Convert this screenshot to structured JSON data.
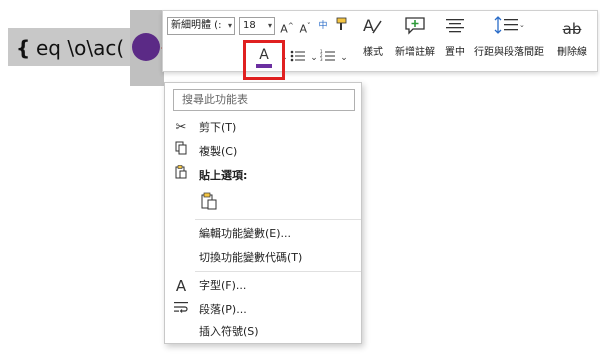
{
  "document": {
    "field_brace": "{",
    "field_code": "eq \\o\\ac("
  },
  "colors": {
    "circle": "#5b2a86",
    "font_color_bar": "#6b2fa0",
    "highlight_box": "#e02020",
    "arrow": "#e02020"
  },
  "toolbar": {
    "font_name": "新細明體 (:",
    "font_size": "18",
    "grow_label": "A^",
    "shrink_label": "A˅",
    "phonetic_label": "中文",
    "style_label": "樣式",
    "comment_label": "新增註解",
    "center_label": "置中",
    "spacing_label": "行距與段落間距",
    "strike_label": "刪除線",
    "font_color_letter": "A"
  },
  "menu": {
    "search_placeholder": "搜尋此功能表",
    "items": [
      {
        "icon": "scissors-icon",
        "label": "剪下(T)"
      },
      {
        "icon": "copy-icon",
        "label": "複製(C)"
      },
      {
        "icon": "paste-icon",
        "label": "貼上選項:"
      },
      {
        "icon": "",
        "label": "編輯功能變數(E)..."
      },
      {
        "icon": "",
        "label": "切換功能變數代碼(T)"
      },
      {
        "icon": "font-icon",
        "label": "字型(F)..."
      },
      {
        "icon": "paragraph-icon",
        "label": "段落(P)..."
      },
      {
        "icon": "",
        "label": "插入符號(S)"
      }
    ]
  }
}
